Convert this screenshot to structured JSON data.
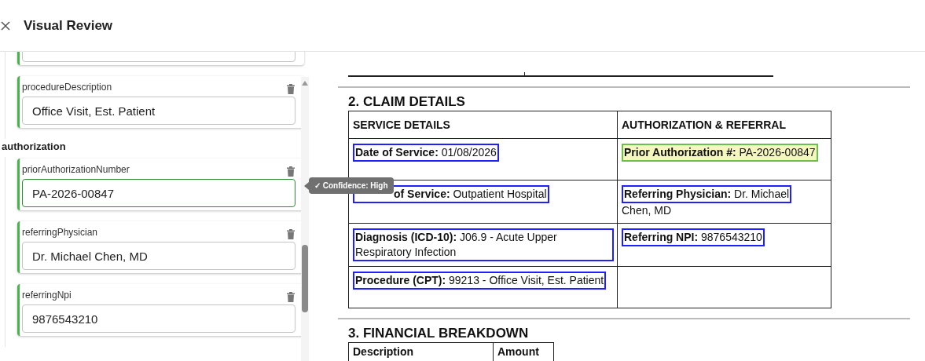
{
  "window": {
    "title": "Visual Review"
  },
  "form": {
    "groups": [
      {
        "fields": [
          {
            "active": false
          },
          {
            "label": "procedureDescription",
            "value": "Office Visit, Est. Patient",
            "active": false
          }
        ]
      },
      {
        "title": "authorization",
        "fields": [
          {
            "label": "priorAuthorizationNumber",
            "value": "PA-2026-00847",
            "active": true,
            "tooltip": "✓ Confidence: High"
          },
          {
            "label": "referringPhysician",
            "value": "Dr. Michael Chen, MD",
            "active": false
          },
          {
            "label": "referringNpi",
            "value": "9876543210",
            "active": false
          }
        ]
      }
    ]
  },
  "document": {
    "sections": [
      {
        "kind": "table_stub"
      },
      {
        "kind": "table",
        "heading": "2. CLAIM DETAILS",
        "table": {
          "columns": [
            "SERVICE DETAILS",
            "AUTHORIZATION & REFERRAL"
          ],
          "rows": [
            [
              {
                "text": "**Date of Service:** 01/08/2026",
                "selected": false
              },
              {
                "text": "**Prior Authorization #:** PA-2026-00847",
                "selected": true
              }
            ],
            [
              {
                "text": "**of Service:** Outpatient Hospital",
                "selected": false,
                "partly_covered": true
              },
              {
                "text": "**Referring Physician:** Dr. Michael",
                "rest": "Chen, MD",
                "selected": false
              }
            ],
            [
              {
                "text": "**Diagnosis (ICD-10):** J06.9 - Acute Upper Respiratory Infection",
                "selected": false
              },
              {
                "text": "**Referring NPI:** 9876543210",
                "selected": false
              }
            ],
            [
              {
                "text": "**Procedure (CPT):** 99213 - Office Visit, Est. Patient",
                "selected": false
              },
              {}
            ]
          ]
        }
      },
      {
        "kind": "table",
        "heading": "3. FINANCIAL BREAKDOWN",
        "table": {
          "columns": [
            "Description",
            "Amount"
          ]
        }
      }
    ]
  }
}
